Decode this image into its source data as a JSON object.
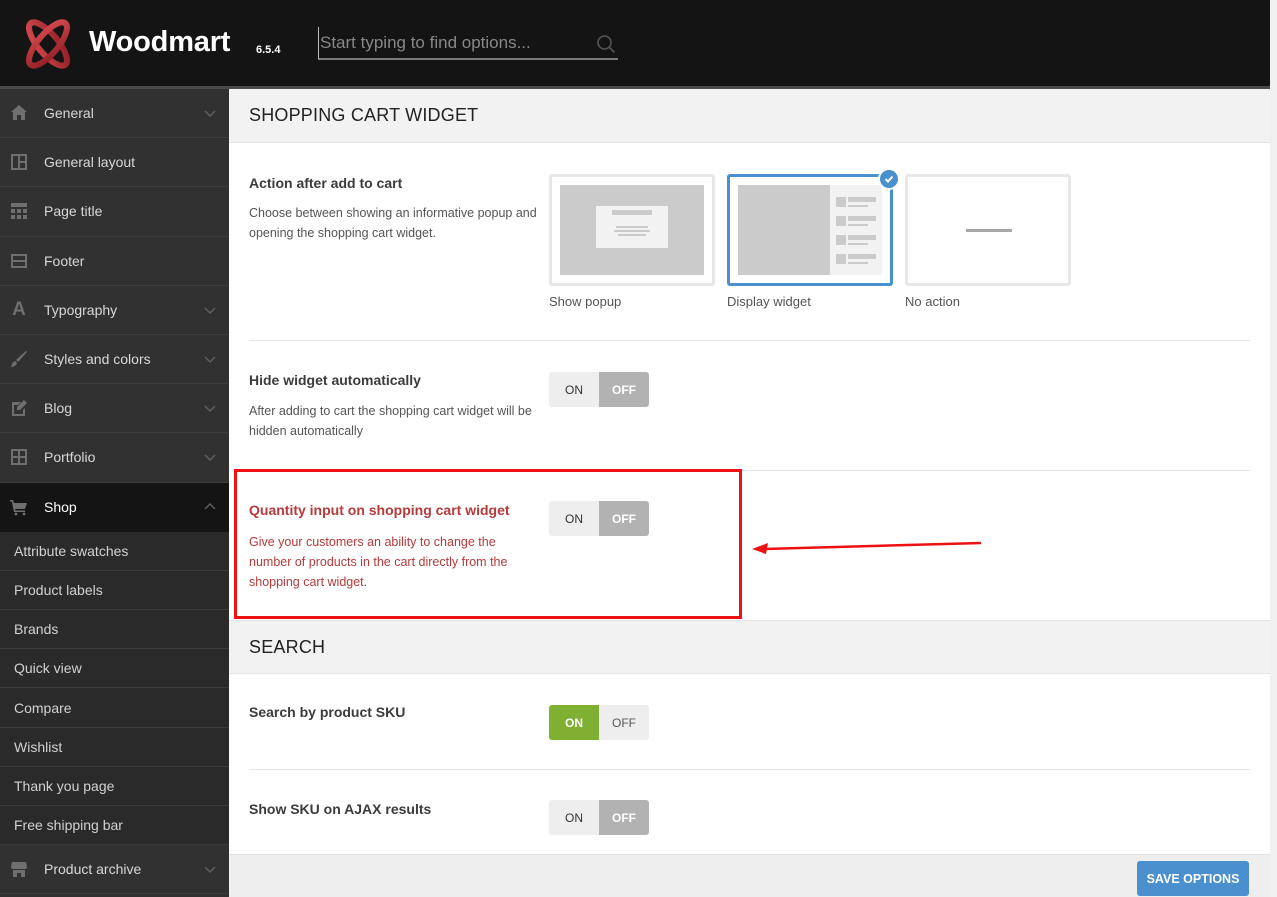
{
  "header": {
    "brand": "Woodmart",
    "version": "6.5.4",
    "search_placeholder": "Start typing to find options..."
  },
  "sidebar": {
    "items": [
      {
        "label": "General",
        "icon": "home-icon",
        "expandable": true
      },
      {
        "label": "General layout",
        "icon": "layout-icon",
        "expandable": false
      },
      {
        "label": "Page title",
        "icon": "page-title-icon",
        "expandable": false
      },
      {
        "label": "Footer",
        "icon": "footer-icon",
        "expandable": false
      },
      {
        "label": "Typography",
        "icon": "typography-icon",
        "expandable": true
      },
      {
        "label": "Styles and colors",
        "icon": "brush-icon",
        "expandable": true
      },
      {
        "label": "Blog",
        "icon": "edit-icon",
        "expandable": true
      },
      {
        "label": "Portfolio",
        "icon": "grid-icon",
        "expandable": true
      },
      {
        "label": "Shop",
        "icon": "cart-icon",
        "expandable": true,
        "active": true
      }
    ],
    "shop_subitems": [
      "Attribute swatches",
      "Product labels",
      "Brands",
      "Quick view",
      "Compare",
      "Wishlist",
      "Thank you page",
      "Free shipping bar"
    ],
    "after_items": [
      {
        "label": "Product archive",
        "icon": "store-icon",
        "expandable": true
      }
    ]
  },
  "sections": {
    "cart_widget": {
      "title": "SHOPPING CART WIDGET",
      "action_after_add": {
        "title": "Action after add to cart",
        "desc": "Choose between showing an informative popup and opening the shopping cart widget.",
        "options": [
          {
            "label": "Show popup",
            "selected": false
          },
          {
            "label": "Display widget",
            "selected": true
          },
          {
            "label": "No action",
            "selected": false
          }
        ]
      },
      "hide_widget": {
        "title": "Hide widget automatically",
        "desc": "After adding to cart the shopping cart widget will be hidden automatically",
        "value": "OFF"
      },
      "quantity_input": {
        "title": "Quantity input on shopping cart widget",
        "desc": "Give your customers an ability to change the number of products in the cart directly from the shopping cart widget.",
        "value": "OFF"
      }
    },
    "search": {
      "title": "SEARCH",
      "sku_search": {
        "title": "Search by product SKU",
        "value": "ON"
      },
      "sku_ajax": {
        "title": "Show SKU on AJAX results",
        "value": "OFF"
      }
    }
  },
  "toggle_labels": {
    "on": "ON",
    "off": "OFF"
  },
  "footer": {
    "save_label": "SAVE OPTIONS"
  },
  "colors": {
    "accent_blue": "#4a8fce",
    "toggle_on_green": "#7fb032",
    "highlight_red": "#ee1111",
    "brand_red": "#c0353b"
  }
}
